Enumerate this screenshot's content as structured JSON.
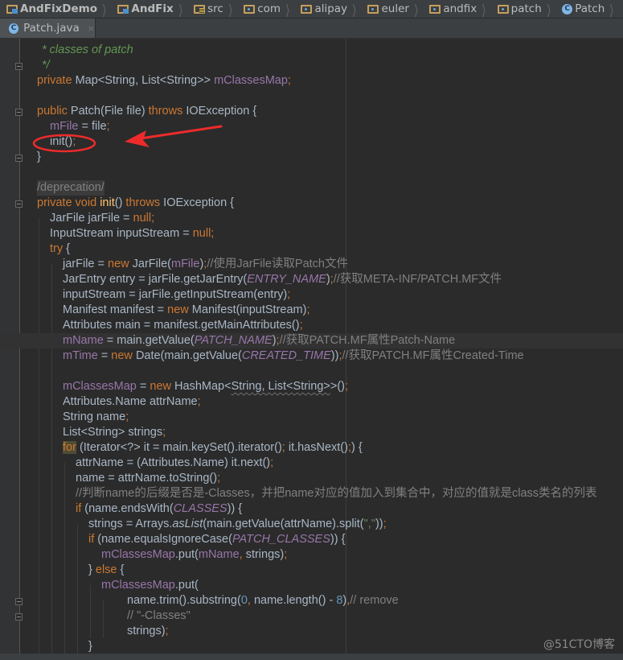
{
  "breadcrumb": [
    {
      "label": "AndFixDemo",
      "icon": "module-folder-icon",
      "bold": true
    },
    {
      "label": "AndFix",
      "icon": "module-folder-icon",
      "bold": true
    },
    {
      "label": "src",
      "icon": "source-folder-icon",
      "bold": false
    },
    {
      "label": "com",
      "icon": "package-folder-icon",
      "bold": false
    },
    {
      "label": "alipay",
      "icon": "package-folder-icon",
      "bold": false
    },
    {
      "label": "euler",
      "icon": "package-folder-icon",
      "bold": false
    },
    {
      "label": "andfix",
      "icon": "package-folder-icon",
      "bold": false
    },
    {
      "label": "patch",
      "icon": "package-folder-icon",
      "bold": false
    },
    {
      "label": "Patch",
      "icon": "class-icon",
      "bold": false
    }
  ],
  "class_icon_glyph": "C",
  "tab": {
    "label": "Patch.java",
    "close_glyph": "×"
  },
  "code": {
    "l01": "* classes of patch",
    "l02": "*/",
    "l03": {
      "kw": "private ",
      "type": "Map<String, List<String>> ",
      "field": "mClassesMap",
      "semi": ";"
    },
    "l05": {
      "kw1": "public ",
      "sig": "Patch(File file) ",
      "kw2": "throws ",
      "rest": "IOException {"
    },
    "l06": {
      "field": "mFile",
      "rest": " = file",
      "semi": ";"
    },
    "l07": {
      "rest": "init()",
      "semi": ";"
    },
    "l08": "}",
    "l10": "/deprecation/",
    "l11": {
      "kw1": "private void ",
      "fn": "init",
      "mid": "() ",
      "kw2": "throws ",
      "rest": "IOException {"
    },
    "l12": {
      "a": "JarFile jarFile = ",
      "kw": "null",
      "semi": ";"
    },
    "l13": {
      "a": "InputStream inputStream = ",
      "kw": "null",
      "semi": ";"
    },
    "l14": {
      "kw": "try",
      "rest": " {"
    },
    "l15": {
      "a": "jarFile = ",
      "kw": "new ",
      "b": "JarFile(",
      "field": "mFile",
      "c": ")",
      "semi": ";",
      "cmt": "//使用JarFile读取Patch文件"
    },
    "l16": {
      "a": "JarEntry entry = jarFile.getJarEntry(",
      "const": "ENTRY_NAME",
      "c": ")",
      "semi": ";",
      "cmt": "//获取META-INF/PATCH.MF文件"
    },
    "l17": {
      "a": "inputStream = jarFile.getInputStream(entry)",
      "semi": ";"
    },
    "l18": {
      "a": "Manifest manifest = ",
      "kw": "new ",
      "b": "Manifest(inputStream)",
      "semi": ";"
    },
    "l19": {
      "a": "Attributes main = manifest.getMainAttributes()",
      "semi": ";"
    },
    "l20": {
      "field": "mName",
      "a": " = main.getValue(",
      "const": "PATCH_NAME",
      "c": ")",
      "semi": ";",
      "cmt": "//获取PATCH.MF属性Patch-Name"
    },
    "l21": {
      "field": "mTime",
      "a": " = ",
      "kw": "new ",
      "b": "Date(main.getValue(",
      "const": "CREATED_TIME",
      "c": "))",
      "semi": ";",
      "cmt": "//获取PATCH.MF属性Created-Time"
    },
    "l23": {
      "field": "mClassesMap",
      "a": " = ",
      "kw": "new ",
      "b": "HashMap<",
      "squig": "String, List<String>",
      "c": ">()",
      "semi": ";"
    },
    "l24": {
      "a": "Attributes.Name attrName",
      "semi": ";"
    },
    "l25": {
      "a": "String name",
      "semi": ";"
    },
    "l26": {
      "a": "List<String> strings",
      "semi": ";"
    },
    "l27": {
      "kw": "for",
      "a": " (Iterator<?> it = main.keySet().iterator()",
      "semi1": ";",
      "b": " it.hasNext()",
      "semi2": ";",
      "c": ") {"
    },
    "l28": {
      "a": "attrName = (Attributes.Name) it.next()",
      "semi": ";"
    },
    "l29": {
      "a": "name = attrName.toString()",
      "semi": ";"
    },
    "l30": "//判断name的后缀是否是-Classes，并把name对应的值加入到集合中，对应的值就是class类名的列表",
    "l31": {
      "kw": "if ",
      "a": "(name.endsWith(",
      "const": "CLASSES",
      "c": ")) {"
    },
    "l32": {
      "a": "strings = Arrays.",
      "it": "asList",
      "b": "(main.getValue(attrName).split(",
      "str": "\",\"",
      "c": "))",
      "semi": ";"
    },
    "l33": {
      "kw": "if ",
      "a": "(name.equalsIgnoreCase(",
      "const": "PATCH_CLASSES",
      "c": ")) {"
    },
    "l34": {
      "field": "mClassesMap",
      "a": ".put(",
      "field2": "mName",
      "comma": ",",
      "b": " strings)",
      "semi": ";"
    },
    "l35": {
      "a": "} ",
      "kw": "else",
      "b": " {"
    },
    "l36": {
      "field": "mClassesMap",
      "a": ".put("
    },
    "l37": {
      "a": "name.trim().substring(",
      "n1": "0",
      "comma": ",",
      "b": " name.length() - ",
      "n2": "8",
      "c": ")",
      "comma2": ",",
      "cmt": "// remove"
    },
    "l38": "// \"-Classes\"",
    "l39": {
      "a": "strings)",
      "semi": ";"
    },
    "l40": "}"
  },
  "annotation": {
    "color": "#ee2b2b",
    "target": "init();"
  },
  "watermark": "@51CTO博客",
  "colors": {
    "background": "#2b2b2b",
    "keyword": "#cc7832",
    "field": "#9876aa",
    "comment": "#808080",
    "doc_comment": "#629755",
    "number": "#6897bb",
    "default_text": "#a9b7c6"
  }
}
